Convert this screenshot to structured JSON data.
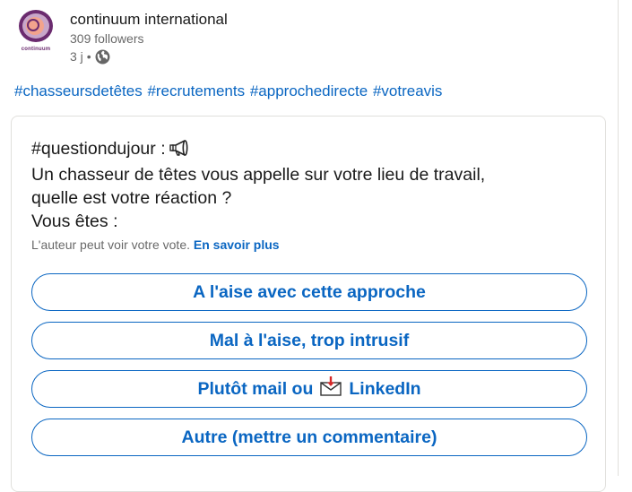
{
  "post": {
    "author": {
      "name": "continuum international",
      "followers": "309 followers",
      "time": "3 j",
      "separator": "•",
      "logo_text": "continuum",
      "logo_colors": {
        "ring": "#6b2b6f",
        "fill": "#f2a38d",
        "inner": "#c8a6c9"
      },
      "visibility_icon": "globe-icon"
    },
    "hashtags": [
      "#chasseursdetêtes",
      "#recrutements",
      "#approchedirecte",
      "#votreavis"
    ]
  },
  "poll": {
    "question_lines": [
      "#questiondujour :",
      "Un chasseur de têtes vous appelle sur votre lieu de travail,",
      "quelle est votre réaction ?",
      "Vous êtes :"
    ],
    "question_icon": "megaphone-icon",
    "author_note": "L'auteur peut voir votre vote.",
    "learn_more": "En savoir plus",
    "options": [
      {
        "label": "A l'aise avec cette approche"
      },
      {
        "label": "Mal à l'aise, trop intrusif"
      },
      {
        "label_before": "Plutôt mail ou",
        "icon": "envelope-icon",
        "label_after": "LinkedIn"
      },
      {
        "label": "Autre (mettre un commentaire)"
      }
    ]
  },
  "colors": {
    "link_blue": "#0a66c2",
    "text_primary": "rgba(0,0,0,0.9)",
    "text_secondary": "rgba(0,0,0,0.6)",
    "border": "#e0dfdc"
  }
}
